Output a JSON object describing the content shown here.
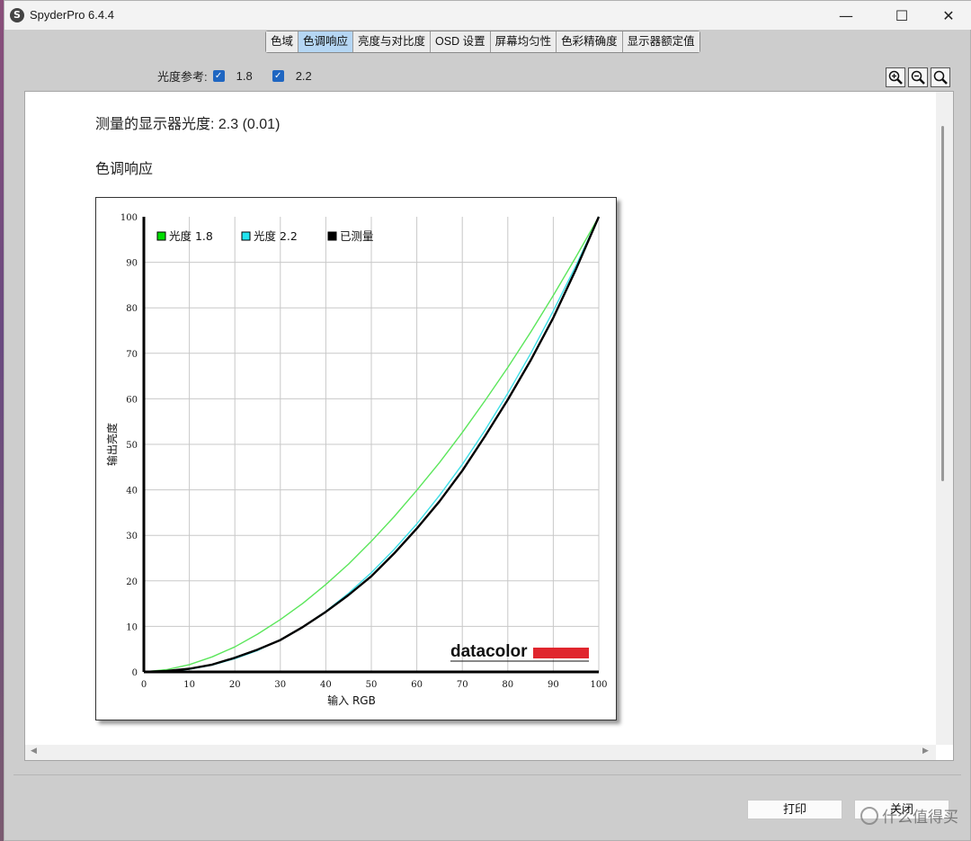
{
  "window": {
    "title": "SpyderPro 6.4.4",
    "app_icon_letter": "S",
    "minimize": "—",
    "maximize": "☐",
    "close": "✕"
  },
  "tabs": [
    {
      "label": "色域",
      "active": false
    },
    {
      "label": "色调响应",
      "active": true
    },
    {
      "label": "亮度与对比度",
      "active": false
    },
    {
      "label": "OSD 设置",
      "active": false
    },
    {
      "label": "屏幕均匀性",
      "active": false
    },
    {
      "label": "色彩精确度",
      "active": false
    },
    {
      "label": "显示器额定值",
      "active": false
    }
  ],
  "gamma_reference": {
    "label": "光度参考:",
    "options": [
      {
        "value": "1.8",
        "checked": true
      },
      {
        "value": "2.2",
        "checked": true
      }
    ]
  },
  "zoom_tools": [
    "zoom-in-icon",
    "zoom-out-icon",
    "zoom-fit-icon"
  ],
  "report": {
    "measured_label": "测量的显示器光度:",
    "measured_value": "2.3 (0.01)",
    "section_title": "色调响应"
  },
  "chart_data": {
    "type": "line",
    "xlabel": "输入 RGB",
    "ylabel": "输出亮度",
    "xlim": [
      0,
      100
    ],
    "ylim": [
      0,
      100
    ],
    "xticks": [
      0,
      10,
      20,
      30,
      40,
      50,
      60,
      70,
      80,
      90,
      100
    ],
    "yticks": [
      0,
      10,
      20,
      30,
      40,
      50,
      60,
      70,
      80,
      90,
      100
    ],
    "grid": true,
    "legend_position": "top-left",
    "watermark": "datacolor",
    "series": [
      {
        "name": "光度 1.8",
        "color": "#5be65b",
        "swatch": "#00dd00",
        "width": 1.4,
        "x": [
          0,
          5,
          10,
          15,
          20,
          25,
          30,
          35,
          40,
          45,
          50,
          55,
          60,
          65,
          70,
          75,
          80,
          85,
          90,
          95,
          100
        ],
        "y": [
          0,
          0.5,
          1.6,
          3.3,
          5.5,
          8.3,
          11.5,
          15.1,
          19.2,
          23.7,
          28.7,
          34.1,
          39.9,
          46.0,
          52.6,
          59.6,
          66.9,
          74.6,
          82.7,
          91.2,
          100
        ]
      },
      {
        "name": "光度 2.2",
        "color": "#3fe0e8",
        "swatch": "#22e5f0",
        "width": 1.4,
        "x": [
          0,
          5,
          10,
          15,
          20,
          25,
          30,
          35,
          40,
          45,
          50,
          55,
          60,
          65,
          70,
          75,
          80,
          85,
          90,
          95,
          100
        ],
        "y": [
          0,
          0.1,
          0.6,
          1.5,
          2.9,
          4.7,
          7.1,
          9.9,
          13.3,
          17.3,
          21.8,
          26.9,
          32.5,
          38.8,
          45.6,
          53.1,
          61.2,
          69.9,
          79.3,
          89.3,
          100
        ]
      },
      {
        "name": "已测量",
        "color": "#000000",
        "swatch": "#000000",
        "width": 2.4,
        "x": [
          0,
          5,
          10,
          15,
          20,
          25,
          30,
          35,
          40,
          45,
          50,
          55,
          60,
          65,
          70,
          75,
          80,
          85,
          90,
          95,
          100
        ],
        "y": [
          0,
          0.2,
          0.7,
          1.6,
          3.1,
          4.9,
          7.0,
          9.9,
          13.2,
          16.9,
          21.0,
          26.0,
          31.5,
          37.5,
          44.2,
          51.8,
          59.8,
          68.4,
          77.8,
          88.5,
          100
        ]
      }
    ]
  },
  "buttons": {
    "print": "打印",
    "close": "关闭"
  },
  "watermark": {
    "text": "什么值得买"
  }
}
